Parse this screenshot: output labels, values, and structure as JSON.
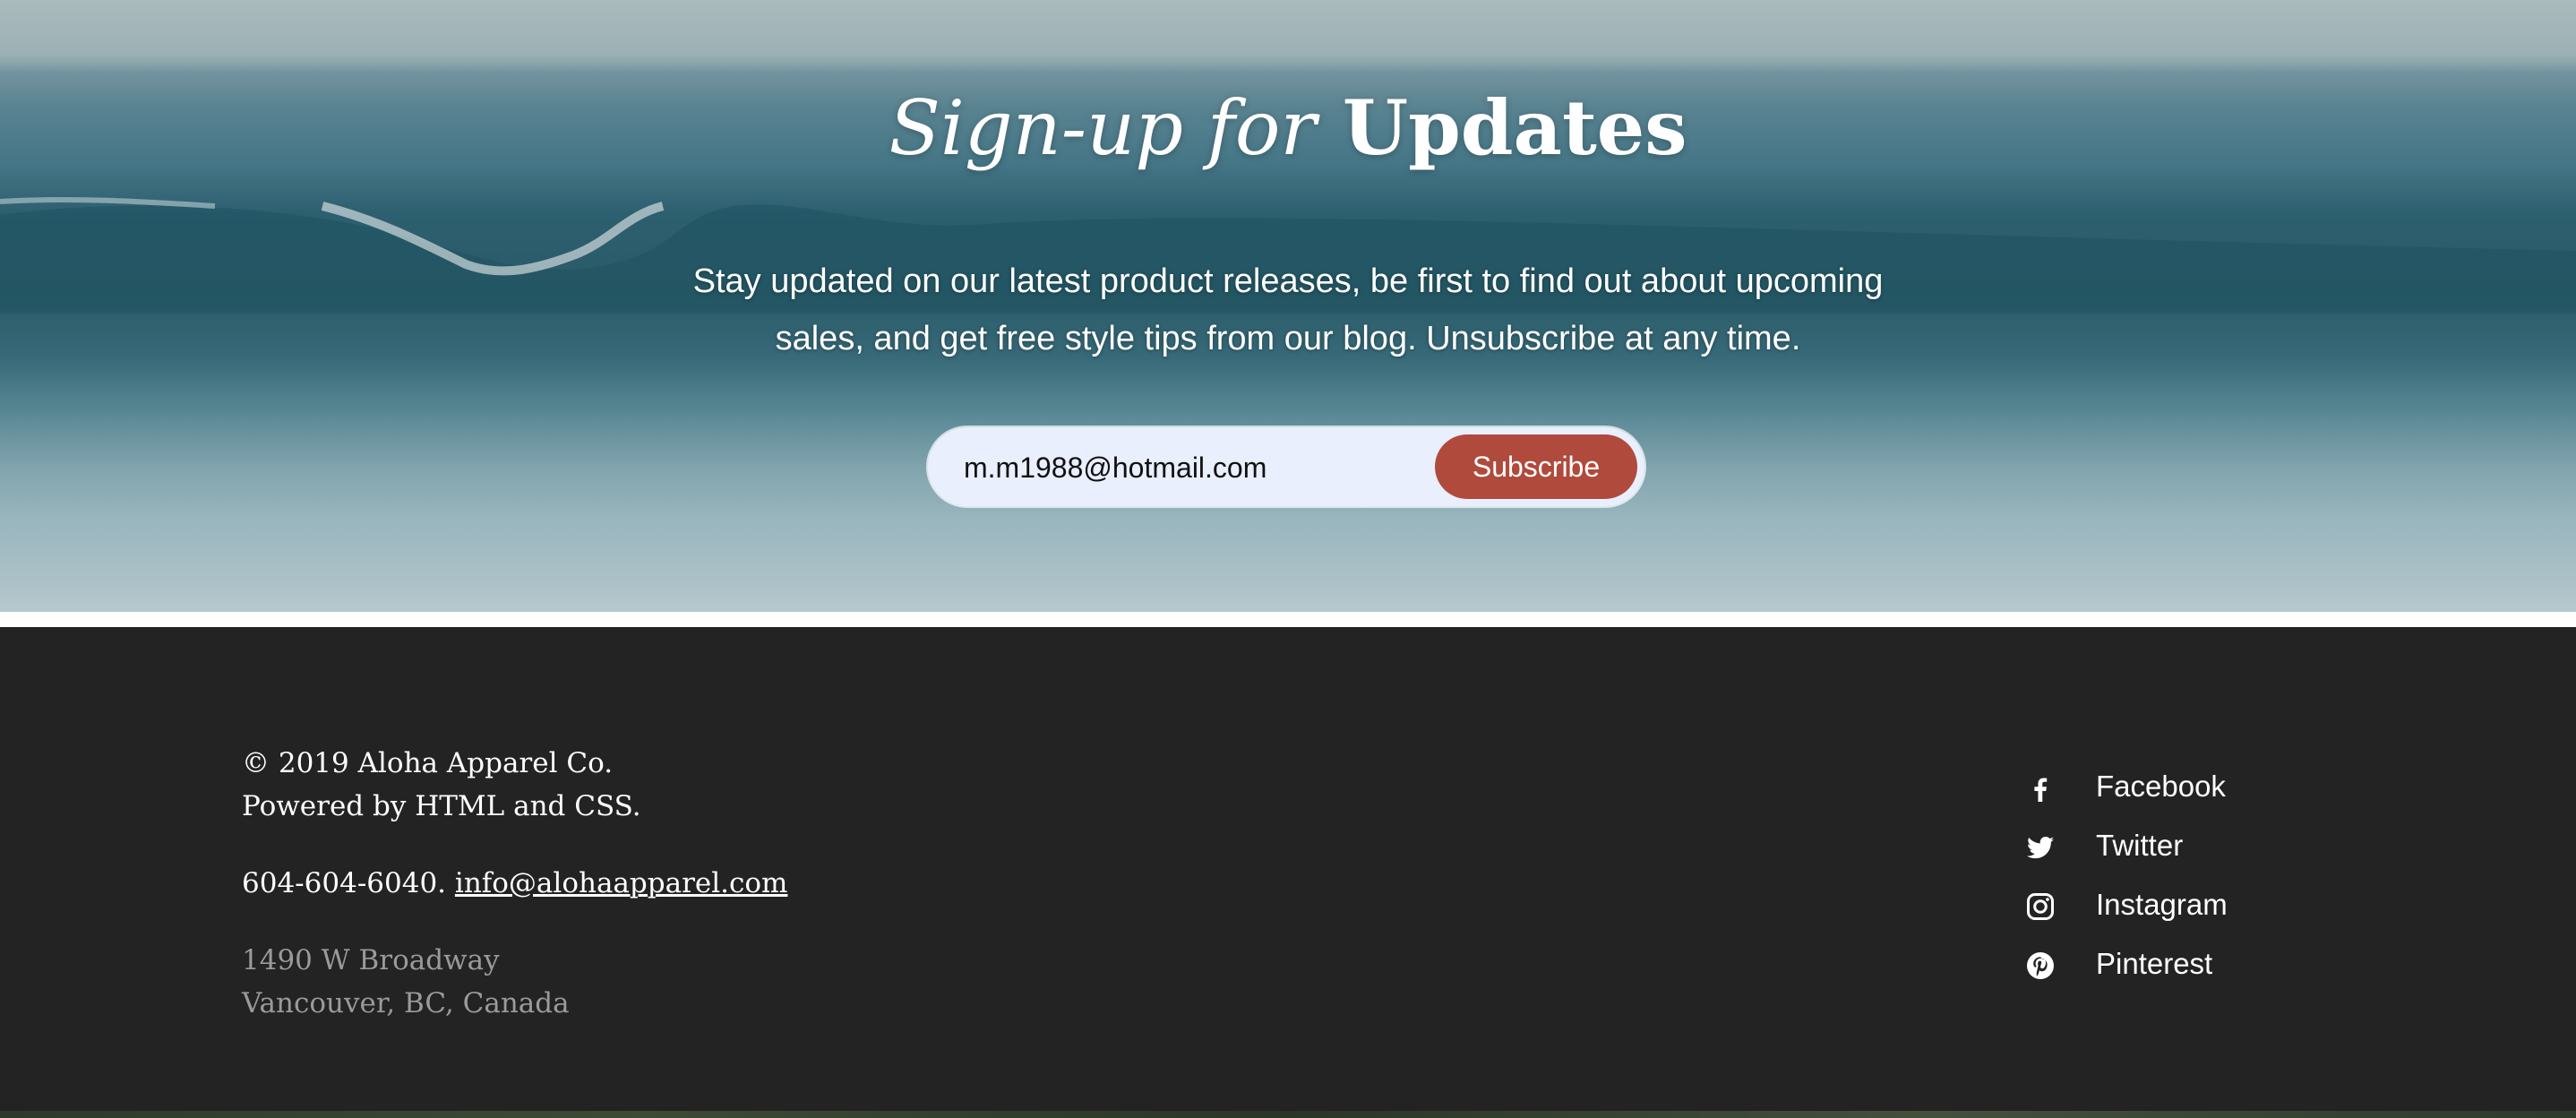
{
  "signup": {
    "title_italic": "Sign-up for",
    "title_bold": "Updates",
    "description": "Stay updated on our latest product releases, be first to find out about upcoming sales, and get free style tips from our blog. Unsubscribe at any time.",
    "email_value": "m.m1988@hotmail.com",
    "subscribe_label": "Subscribe",
    "accent_color": "#b04a3c"
  },
  "footer": {
    "copyright": "© 2019 Aloha Apparel Co.",
    "powered": "Powered by HTML and CSS.",
    "phone": "604-604-6040.",
    "email": "info@alohaapparel.com",
    "address_line1": "1490 W Broadway",
    "address_line2": "Vancouver, BC, Canada",
    "background_color": "#232323",
    "social": [
      {
        "label": "Facebook",
        "icon": "facebook-icon"
      },
      {
        "label": "Twitter",
        "icon": "twitter-icon"
      },
      {
        "label": "Instagram",
        "icon": "instagram-icon"
      },
      {
        "label": "Pinterest",
        "icon": "pinterest-icon"
      }
    ]
  }
}
